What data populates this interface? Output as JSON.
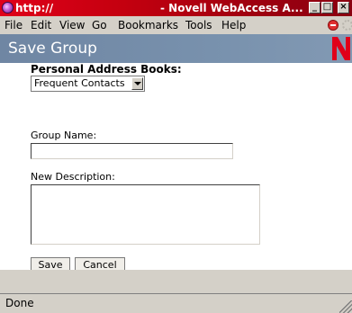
{
  "window": {
    "url": "http://",
    "title": "- Novell WebAccess A...",
    "controls": {
      "min": "_",
      "max": "□",
      "close": "×"
    }
  },
  "menu": {
    "file": "File",
    "edit": "Edit",
    "view": "View",
    "go": "Go",
    "bookmarks": "Bookmarks",
    "tools": "Tools",
    "help": "Help"
  },
  "page": {
    "title": "Save Group",
    "logo_letter": "N"
  },
  "form": {
    "address_books_label": "Personal Address Books:",
    "address_book_selected": "Frequent Contacts",
    "group_name_label": "Group Name:",
    "group_name_value": "",
    "description_label": "New Description:",
    "description_value": "",
    "save_label": "Save",
    "cancel_label": "Cancel"
  },
  "status": {
    "text": "Done"
  },
  "colors": {
    "titlebar": "#c4000f",
    "header_band": "#7891ad",
    "logo": "#e0001a",
    "chrome": "#d4d0c8"
  }
}
